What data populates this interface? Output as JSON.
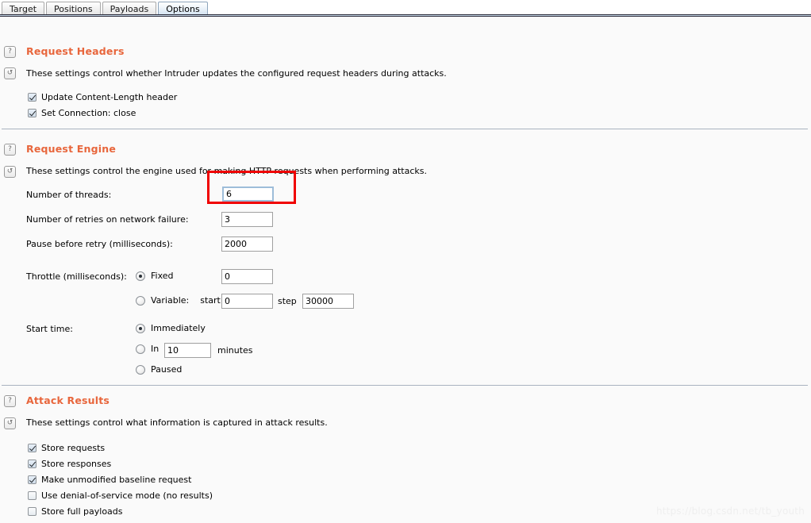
{
  "tabs": [
    {
      "label": "Target",
      "selected": false
    },
    {
      "label": "Positions",
      "selected": false
    },
    {
      "label": "Payloads",
      "selected": false
    },
    {
      "label": "Options",
      "selected": true
    }
  ],
  "icons": {
    "help": "?",
    "reset": "↺"
  },
  "colors": {
    "section_title": "#e8663c",
    "highlight": "#f00000",
    "divider": "#a9b3c0",
    "tab_selected": "#cfe0ef",
    "page_background": "#fafafa",
    "focus_border": "#9dbdd9"
  },
  "sections": {
    "request_headers": {
      "title": "Request Headers",
      "description": "These settings control whether Intruder updates the configured request headers during attacks.",
      "checkboxes": [
        {
          "label": "Update Content-Length header",
          "checked": true
        },
        {
          "label": "Set Connection: close",
          "checked": true
        }
      ]
    },
    "request_engine": {
      "title": "Request Engine",
      "description": "These settings control the engine used for making HTTP requests when performing attacks.",
      "fields": {
        "threads": {
          "label": "Number of threads:",
          "value": "6",
          "focused": true,
          "highlighted": true
        },
        "retries": {
          "label": "Number of retries on network failure:",
          "value": "3",
          "focused": false,
          "highlighted": false
        },
        "pause": {
          "label": "Pause before retry (milliseconds):",
          "value": "2000",
          "focused": false,
          "highlighted": false
        }
      },
      "throttle": {
        "label": "Throttle (milliseconds):",
        "fixed": {
          "label": "Fixed",
          "selected": true,
          "value": "0"
        },
        "variable": {
          "label": "Variable:",
          "selected": false,
          "start_label": "start",
          "start_value": "0",
          "step_label": "step",
          "step_value": "30000"
        }
      },
      "start_time": {
        "label": "Start time:",
        "options": [
          {
            "label": "Immediately",
            "selected": true,
            "type": "plain"
          },
          {
            "label": "In",
            "selected": false,
            "type": "input",
            "value": "10",
            "suffix": "minutes"
          },
          {
            "label": "Paused",
            "selected": false,
            "type": "plain"
          }
        ]
      }
    },
    "attack_results": {
      "title": "Attack Results",
      "description": "These settings control what information is captured in attack results.",
      "checkboxes": [
        {
          "label": "Store requests",
          "checked": true
        },
        {
          "label": "Store responses",
          "checked": true
        },
        {
          "label": "Make unmodified baseline request",
          "checked": true
        },
        {
          "label": "Use denial-of-service mode (no results)",
          "checked": false
        },
        {
          "label": "Store full payloads",
          "checked": false
        }
      ]
    }
  },
  "watermark": "https://blog.csdn.net/tb_youth"
}
